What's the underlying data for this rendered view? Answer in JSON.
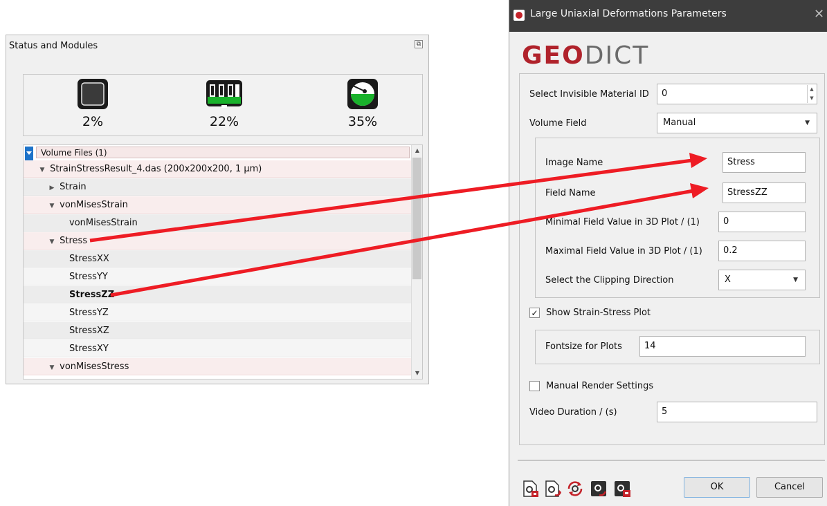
{
  "status_panel": {
    "title": "Status and Modules",
    "gauges": [
      {
        "name": "cpu",
        "value": "2%"
      },
      {
        "name": "memory",
        "value": "22%"
      },
      {
        "name": "disk",
        "value": "35%"
      }
    ],
    "tree": {
      "root": "Volume Files (1)",
      "rows": [
        {
          "text": "StrainStressResult_4.das (200x200x200, 1 μm)"
        },
        {
          "text": "Strain"
        },
        {
          "text": "vonMisesStrain"
        },
        {
          "text": "vonMisesStrain"
        },
        {
          "text": "Stress"
        },
        {
          "text": "StressXX"
        },
        {
          "text": "StressYY"
        },
        {
          "text": "StressZZ"
        },
        {
          "text": "StressYZ"
        },
        {
          "text": "StressXZ"
        },
        {
          "text": "StressXY"
        },
        {
          "text": "vonMisesStress"
        }
      ]
    }
  },
  "dialog": {
    "title": "Large Uniaxial Deformations Parameters",
    "logo": {
      "geo": "GEO",
      "dict": "DICT"
    },
    "invisible_material": {
      "label": "Select Invisible Material ID",
      "value": "0"
    },
    "volume_field": {
      "label": "Volume Field",
      "value": "Manual"
    },
    "image_name": {
      "label": "Image Name",
      "value": "Stress"
    },
    "field_name": {
      "label": "Field Name",
      "value": "StressZZ"
    },
    "min_field": {
      "label": "Minimal Field Value in 3D Plot / (1)",
      "value": "0"
    },
    "max_field": {
      "label": "Maximal Field Value in 3D Plot / (1)",
      "value": "0.2"
    },
    "clipping": {
      "label": "Select the Clipping Direction",
      "value": "X"
    },
    "show_plot": {
      "label": "Show Strain-Stress Plot",
      "checked": true
    },
    "fontsize": {
      "label": "Fontsize for Plots",
      "value": "14"
    },
    "manual_render": {
      "label": "Manual Render Settings",
      "checked": false
    },
    "video_duration": {
      "label": "Video Duration / (s)",
      "value": "5"
    },
    "ok": "OK",
    "cancel": "Cancel"
  },
  "colors": {
    "accent_red": "#b0222b",
    "arrow_red": "#ee1c24",
    "gauge_green": "#19b22b",
    "selection_blue": "#1d73c9"
  }
}
